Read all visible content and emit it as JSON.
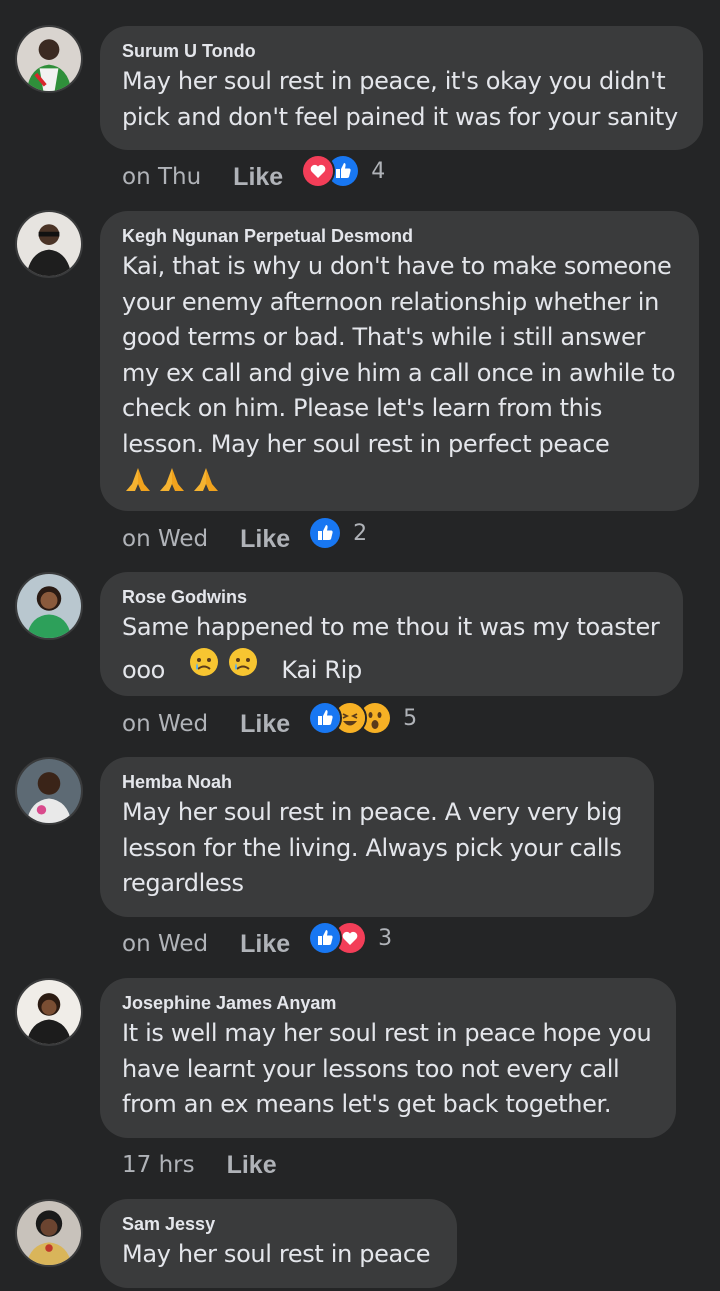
{
  "colors": {
    "background": "#242526",
    "bubble": "#3a3b3c",
    "text": "#e4e6eb",
    "secondary_text": "#b0b3b8",
    "like_blue": "#1877f2",
    "love_red": "#f33e58",
    "haha_yellow": "#f7b125"
  },
  "comments": [
    {
      "author": "Surum U Tondo",
      "lines": [
        "May her soul rest in peace, it's okay you didn't",
        "pick and don't feel pained it was for your sanity"
      ],
      "time": "on Thu",
      "like_label": "Like",
      "reactions": [
        "love-icon",
        "like-icon"
      ],
      "reaction_count": "4"
    },
    {
      "author": "Kegh Ngunan Perpetual Desmond",
      "lines": [
        "Kai, that is why u don't have to make someone",
        "your enemy afternoon relationship whether in",
        "good terms or bad. That's while i still answer",
        "my ex call and give him a call once in awhile to",
        "check on him. Please let's learn from this",
        "lesson. May her soul rest in perfect peace"
      ],
      "emoji_line": [
        "folded-hands-emoji",
        "folded-hands-emoji",
        "folded-hands-emoji"
      ],
      "time": "on Wed",
      "like_label": "Like",
      "reactions": [
        "like-icon"
      ],
      "reaction_count": "2"
    },
    {
      "author": "Rose Godwins",
      "lines": [
        "Same happened to me thou it was my toaster"
      ],
      "last_line_prefix": "ooo",
      "last_line_suffix": "Kai Rip",
      "inline_emojis": [
        "crying-face-emoji",
        "crying-face-emoji"
      ],
      "time": "on Wed",
      "like_label": "Like",
      "reactions": [
        "like-icon",
        "haha-icon",
        "wow-icon"
      ],
      "reaction_count": "5"
    },
    {
      "author": "Hemba Noah",
      "lines": [
        "May her soul rest in peace. A very very big",
        "lesson for the living. Always pick your calls",
        "regardless"
      ],
      "time": "on Wed",
      "like_label": "Like",
      "reactions": [
        "like-icon",
        "love-icon"
      ],
      "reaction_count": "3"
    },
    {
      "author": "Josephine James Anyam",
      "lines": [
        "It is well may her soul rest in peace hope you",
        "have learnt your lessons too not every call",
        "from an ex means let's get back together."
      ],
      "time": "17 hrs",
      "like_label": "Like",
      "reactions": [],
      "reaction_count": ""
    },
    {
      "author": "Sam Jessy",
      "lines": [
        "May her soul rest in peace"
      ],
      "reactions": []
    }
  ]
}
